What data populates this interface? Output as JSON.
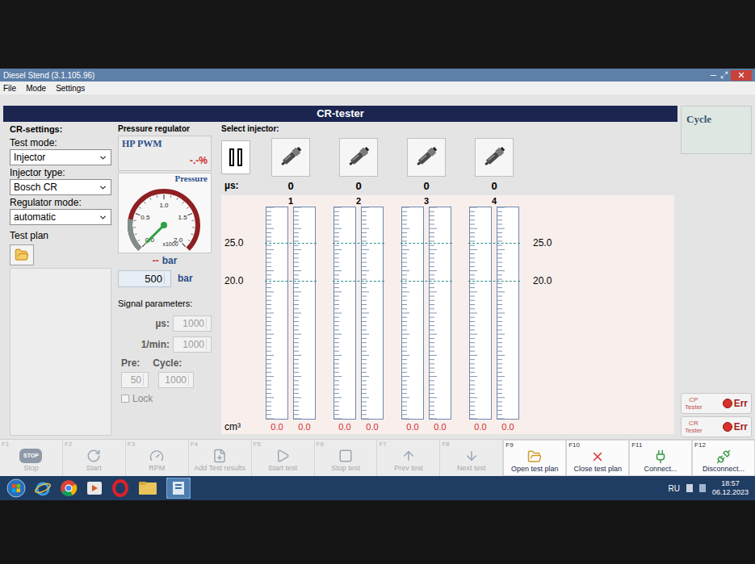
{
  "window": {
    "title": "Diesel Stend (3.1.105.96)",
    "menu": [
      "File",
      "Mode",
      "Settings"
    ]
  },
  "header": "CR-tester",
  "settings": {
    "title": "CR-settings:",
    "fields": [
      {
        "label": "Test mode:",
        "value": "Injector"
      },
      {
        "label": "Injector type:",
        "value": "Bosch CR"
      },
      {
        "label": "Regulator mode:",
        "value": "automatic"
      }
    ],
    "test_plan": "Test plan"
  },
  "regulator": {
    "title": "Pressure regulator",
    "mode": "HP PWM",
    "reading": "-.-%",
    "gauge": {
      "title": "Pressure",
      "ticks": [
        "0.0",
        "0.5",
        "1.0",
        "1.5",
        "2.0"
      ],
      "multiplier": "x1000",
      "level": 0,
      "reading": "--",
      "unit": "bar"
    },
    "setpoint": "500",
    "setpoint_unit": "bar"
  },
  "signal": {
    "title": "Signal parameters:",
    "fields": [
      {
        "label": "µs:",
        "value": "1000",
        "disabled": true
      },
      {
        "label": "1/min:",
        "value": "1000",
        "disabled": true
      }
    ],
    "pre": {
      "label": "Pre:",
      "value": "50",
      "disabled": true
    },
    "cycle": {
      "label": "Cycle:",
      "value": "1000",
      "disabled": true
    },
    "lock": {
      "label": "Lock",
      "checked": false,
      "disabled": true
    }
  },
  "injectors": {
    "title": "Select injector:",
    "us_label": "µs:",
    "unit": "cm³",
    "scale": [
      "25.0",
      "20.0"
    ],
    "items": [
      {
        "number": "1",
        "us": "0",
        "tubes": [
          {
            "value": "0.0",
            "level": 0
          },
          {
            "value": "0.0",
            "level": 0
          }
        ]
      },
      {
        "number": "2",
        "us": "0",
        "tubes": [
          {
            "value": "0.0",
            "level": 0
          },
          {
            "value": "0.0",
            "level": 0
          }
        ]
      },
      {
        "number": "3",
        "us": "0",
        "tubes": [
          {
            "value": "0.0",
            "level": 0
          },
          {
            "value": "0.0",
            "level": 0
          }
        ]
      },
      {
        "number": "4",
        "us": "0",
        "tubes": [
          {
            "value": "0.0",
            "level": 0
          },
          {
            "value": "0.0",
            "level": 0
          }
        ]
      }
    ]
  },
  "cycle_panel": {
    "title": "Cycle"
  },
  "testers": [
    {
      "name": "CP",
      "sub": "Tester",
      "status": "Err"
    },
    {
      "name": "CR",
      "sub": "Tester",
      "status": "Err"
    }
  ],
  "toolbar": [
    {
      "key": "F1",
      "label": "Stop",
      "badge": "STOP",
      "disabled": true
    },
    {
      "key": "F2",
      "label": "Start",
      "disabled": true
    },
    {
      "key": "F3",
      "label": "RPM",
      "disabled": true
    },
    {
      "key": "F4",
      "label": "Add Test results",
      "disabled": true
    },
    {
      "key": "F5",
      "label": "Start test",
      "disabled": true
    },
    {
      "key": "F6",
      "label": "Stop test",
      "disabled": true
    },
    {
      "key": "F7",
      "label": "Prev test",
      "disabled": true
    },
    {
      "key": "F8",
      "label": "Next test",
      "disabled": true
    },
    {
      "key": "F9",
      "label": "Open test plan",
      "disabled": false
    },
    {
      "key": "F10",
      "label": "Close test plan",
      "disabled": false
    },
    {
      "key": "F11",
      "label": "Connect...",
      "disabled": false
    },
    {
      "key": "F12",
      "label": "Disconnect...",
      "disabled": false
    }
  ],
  "taskbar": {
    "language": "RU",
    "time": "18:57",
    "date": "06.12.2023"
  }
}
